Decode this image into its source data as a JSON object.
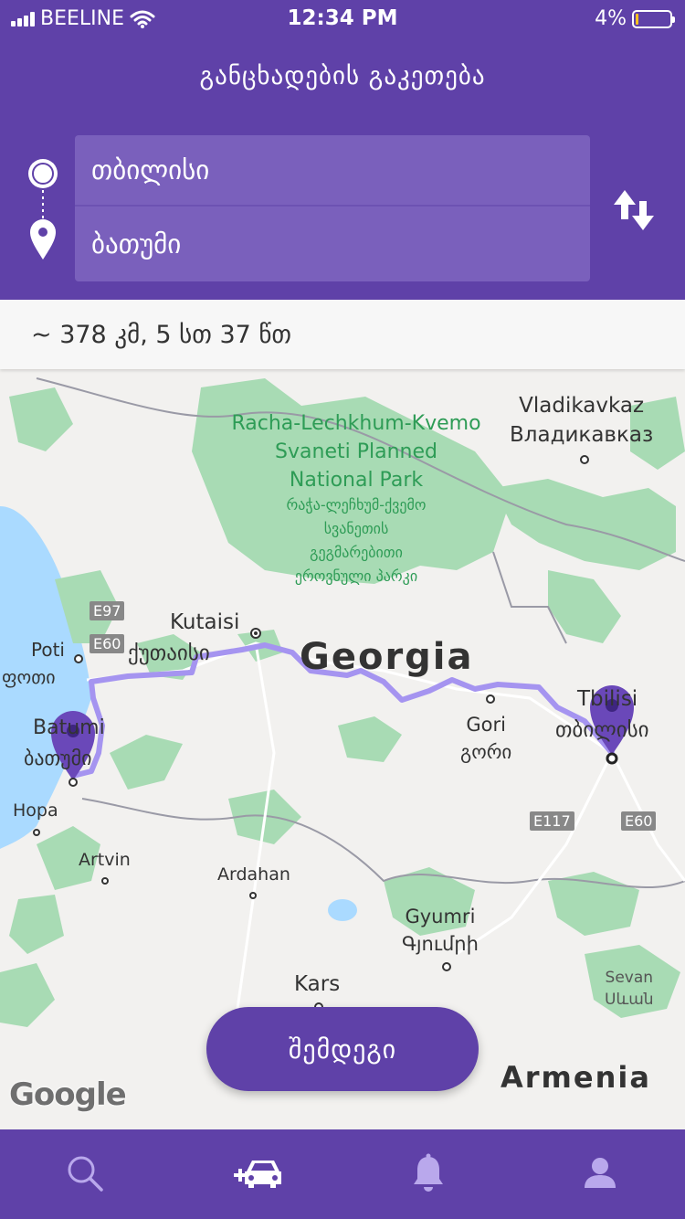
{
  "status_bar": {
    "carrier": "BEELINE",
    "time": "12:34 PM",
    "battery": "4%"
  },
  "header": {
    "title": "განცხადების გაკეთება"
  },
  "route": {
    "from": "თბილისი",
    "to": "ბათუმი",
    "icons": {
      "from": "origin-circle-icon",
      "to": "location-pin-icon",
      "swap": "swap-arrows-icon"
    }
  },
  "summary": {
    "distance": "~ 378 კმ, 5 სთ 37 წთ"
  },
  "map": {
    "park_en": [
      "Racha-Lechkhum-Kvemo",
      "Svaneti Planned",
      "National Park"
    ],
    "park_ka": [
      "რაჭა-ლეჩხუმ-ქვემო",
      "სვანეთის",
      "გეგმარებითი",
      "ეროვნული პარკი"
    ],
    "vladikavkaz_en": "Vladikavkaz",
    "vladikavkaz_ru": "Владикавказ",
    "country_georgia": "Georgia",
    "country_armenia": "Armenia",
    "kutaisi_en": "Kutaisi",
    "kutaisi_ka": "ქუთაისი",
    "poti_en": "Poti",
    "poti_ka": "ფოთი",
    "batumi_en": "Batumi",
    "batumi_ka": "ბათუმი",
    "gori_en": "Gori",
    "gori_ka": "გორი",
    "tbilisi_en": "Tbilisi",
    "tbilisi_ka": "თბილისი",
    "hopa": "Hopa",
    "artvin": "Artvin",
    "ardahan": "Ardahan",
    "gyumri_en": "Gyumri",
    "gyumri_hy": "Գյումրի",
    "kars": "Kars",
    "sevan_en": "Sevan",
    "sevan_hy": "Սևան",
    "roads": {
      "e97": "E97",
      "e60_west": "E60",
      "e117": "E117",
      "e60_east": "E60"
    },
    "google": "Google",
    "colors": {
      "water": "#aadaff",
      "park": "#a8dbb4",
      "route": "#a594f0",
      "pin": "#6a48b9"
    }
  },
  "actions": {
    "next": "შემდეგი"
  },
  "tabbar": {
    "items": [
      {
        "icon": "search-icon"
      },
      {
        "icon": "add-ride-car-icon"
      },
      {
        "icon": "bell-icon"
      },
      {
        "icon": "profile-icon"
      }
    ]
  }
}
